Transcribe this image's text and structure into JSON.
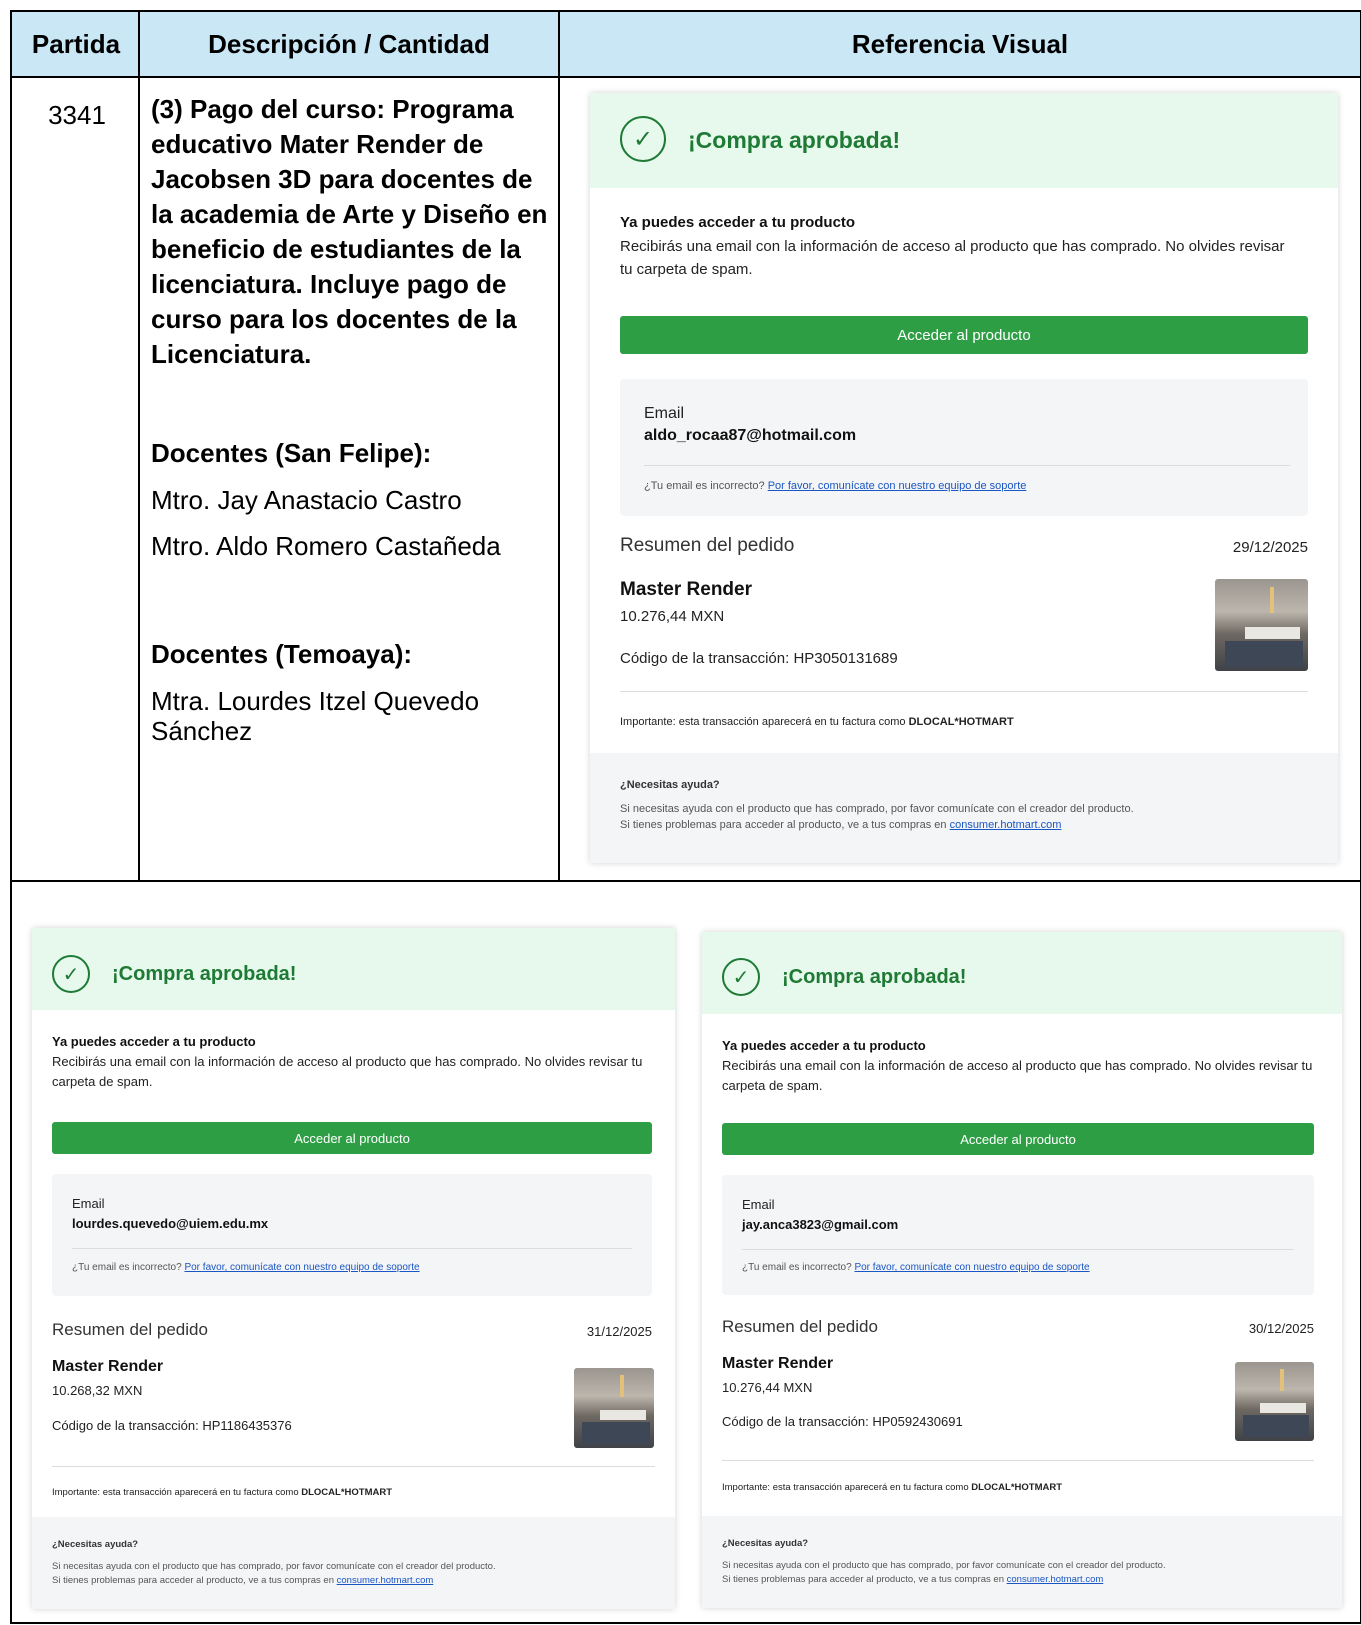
{
  "table": {
    "headers": [
      "Partida",
      "Descripción / Cantidad",
      "Referencia Visual"
    ],
    "row": {
      "partida": "3341",
      "description": "(3) Pago del curso: Programa educativo Mater Render de Jacobsen 3D para docentes de la academia de Arte y Diseño en beneficio de estudiantes de la licenciatura. Incluye pago de curso para los docentes de la Licenciatura.",
      "group1_title": "Docentes (San Felipe):",
      "group1_people": [
        "Mtro. Jay Anastacio Castro",
        "Mtro. Aldo Romero Castañeda"
      ],
      "group2_title": "Docentes (Temoaya):",
      "group2_people": [
        "Mtra. Lourdes Itzel Quevedo Sánchez"
      ]
    }
  },
  "receipt_common": {
    "approved_title": "¡Compra aprobada!",
    "access_heading": "Ya puedes acceder a tu producto",
    "access_text": "Recibirás una email con la información de acceso al producto que has comprado. No olvides revisar tu carpeta de spam.",
    "access_button": "Acceder al producto",
    "email_label": "Email",
    "email_wrong": "¿Tu email es incorrecto?",
    "email_support_link": "Por favor, comunícate con nuestro equipo de soporte",
    "summary_label": "Resumen del pedido",
    "product_name": "Master Render",
    "transaction_label": "Código de la transacción:",
    "important_prefix": "Importante: esta transacción aparecerá en tu factura como",
    "important_brand": "DLOCAL*HOTMART",
    "help_title": "¿Necesitas ayuda?",
    "help_line1": "Si necesitas ayuda con el producto que has comprado, por favor comunícate con el creador del producto.",
    "help_line2": "Si tienes problemas para acceder al producto, ve a tus compras en",
    "help_link": "consumer.hotmart.com"
  },
  "receipts": [
    {
      "email": "aldo_rocaa87@hotmail.com",
      "date": "29/12/2025",
      "price": "10.276,44 MXN",
      "transaction": "HP3050131689"
    },
    {
      "email": "lourdes.quevedo@uiem.edu.mx",
      "date": "31/12/2025",
      "price": "10.268,32 MXN",
      "transaction": "HP1186435376"
    },
    {
      "email": "jay.anca3823@gmail.com",
      "date": "30/12/2025",
      "price": "10.276,44 MXN",
      "transaction": "HP0592430691"
    }
  ],
  "colors": {
    "header_bg": "#c9e7f5",
    "approved_green": "#1e7a34",
    "button_green": "#2e9e45",
    "banner_bg": "#e6f9ec"
  },
  "icons": {
    "check": "check-circle-icon"
  }
}
